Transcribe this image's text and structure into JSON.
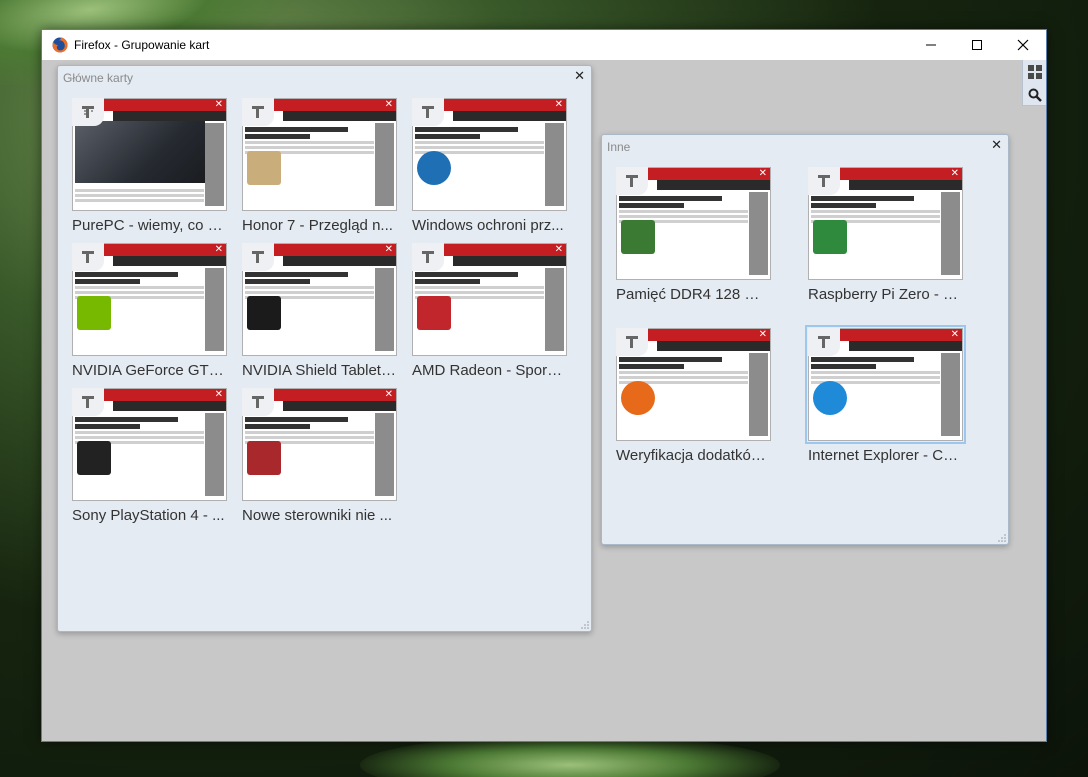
{
  "window": {
    "title": "Firefox - Grupowanie kart",
    "controls": [
      "minimize",
      "maximize",
      "close"
    ]
  },
  "side_tools": [
    {
      "name": "tab-groups-icon"
    },
    {
      "name": "search-icon"
    }
  ],
  "groups": [
    {
      "title": "Główne karty",
      "tabs": [
        {
          "label": "PurePC - wiemy, co si...",
          "thumb_title": "",
          "thumb_style": "dark",
          "image_color": "#2a2e35"
        },
        {
          "label": "Honor 7 - Przegląd n...",
          "thumb_title": "Honor 7 - Przegląd najważniejszych funkcji ciekawego smartfona",
          "thumb_style": "article",
          "image_color": "#c9ad7a"
        },
        {
          "label": "Windows ochroni prz...",
          "thumb_title": "Windows ochroni przed niechcianym oprogramowaniem",
          "thumb_style": "article",
          "image_color": "#1f6fb5"
        },
        {
          "label": "NVIDIA GeForce GTX ...",
          "thumb_title": "NVIDIA GeForce GTX 960 Ti - Premiera nowej karty w styczniu?",
          "thumb_style": "article",
          "image_color": "#76b900"
        },
        {
          "label": "NVIDIA Shield Tablet ...",
          "thumb_title": "NVIDIA Shield Tablet - Nadchodzi nowa wersja z Tegra X1",
          "thumb_style": "article",
          "image_color": "#1b1b1b"
        },
        {
          "label": "AMD Radeon - Spore...",
          "thumb_title": "AMD Radeon - Spore obniżki cen w zagranicznych sklepach",
          "thumb_style": "article",
          "image_color": "#c0262c"
        },
        {
          "label": "Sony PlayStation 4 - ...",
          "thumb_title": "Sony PlayStation 4 - Sprzedano ponad 30 milionów konsol",
          "thumb_style": "article",
          "image_color": "#222222"
        },
        {
          "label": "Nowe sterowniki nie ...",
          "thumb_title": "Nowe sterowniki nie będą wspierały Radeon HD 5000 i HD 6000",
          "thumb_style": "article",
          "image_color": "#a8282c"
        }
      ]
    },
    {
      "title": "Inne",
      "tabs": [
        {
          "label": "Pamięć DDR4 128 GB TS...",
          "thumb_title": "Pamięć DDR4 128 GB TSV - Samsung rozpoczyna masową produkcję",
          "thumb_style": "article",
          "image_color": "#3a7a32"
        },
        {
          "label": "Raspberry Pi Zero - Mini...",
          "thumb_title": "Raspberry Pi Zero - Minikomputer za 5 dolarów",
          "thumb_style": "article",
          "image_color": "#2f8a3e"
        },
        {
          "label": "Weryfikacja dodatków Fi...",
          "thumb_title": "Weryfikacja dodatków Firefoksa ostro krytykowana",
          "thumb_style": "article",
          "image_color": "#e66a1a"
        },
        {
          "label": "Internet Explorer - Czas ...",
          "thumb_title": "Internet Explorer - Czas pożegnać stare wersje przeglądarki",
          "thumb_style": "article",
          "image_color": "#1f8ad8",
          "active": true
        }
      ]
    }
  ],
  "colors": {
    "group_bg": "#e4ebf3",
    "content_bg": "#c8c8c8",
    "site_red": "#c41e22",
    "active_outline": "#9cc7ee"
  }
}
